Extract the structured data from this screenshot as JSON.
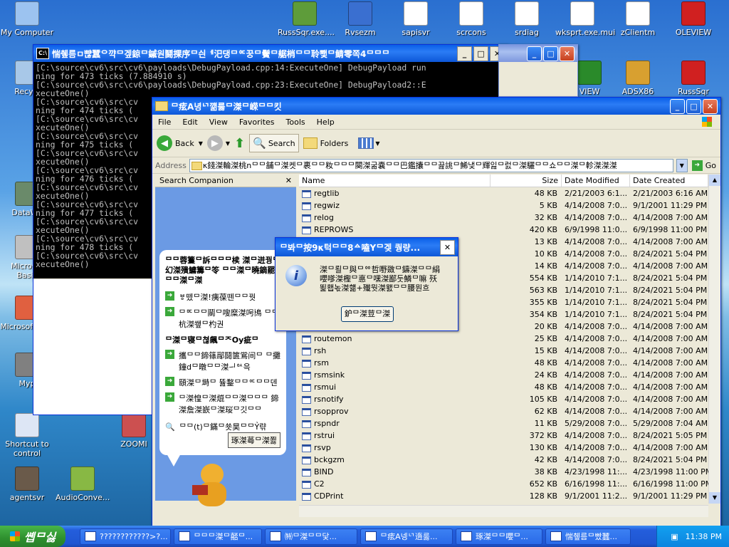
{
  "desktop_icons": [
    {
      "label": "My Computer",
      "color": "#9cc3f0"
    },
    {
      "label": "Recycl",
      "color": "#a8c8e8"
    },
    {
      "label": "DataWa",
      "color": "#6a8a6a"
    },
    {
      "label": "Microsof Basic",
      "color": "#c0c0c0"
    },
    {
      "label": "Microsof C++",
      "color": "#e06040"
    },
    {
      "label": "Myp",
      "color": "#808080"
    },
    {
      "label": "Shortcut to control",
      "color": "#dde6f5"
    },
    {
      "label": "agentsvr",
      "color": "#6a5a4a"
    },
    {
      "label": "AudioConve...",
      "color": "#88b844"
    },
    {
      "label": "ZOOMI",
      "color": "#cc5050"
    },
    {
      "label": "RussSqr.exe....",
      "color": "#5e9c3a"
    },
    {
      "label": "Rvsezm",
      "color": "#3a6fd0"
    },
    {
      "label": "sapisvr",
      "color": "#ffffff"
    },
    {
      "label": "scrcons",
      "color": "#ffffff"
    },
    {
      "label": "srdiag",
      "color": "#ffffff"
    },
    {
      "label": "wksprt.exe.mui",
      "color": "#ffffff"
    },
    {
      "label": "zClientm",
      "color": "#ffffff"
    },
    {
      "label": "OLEVIEW",
      "color": "#d02020"
    },
    {
      "label": "VIEW",
      "color": "#2a8a2a"
    },
    {
      "label": "ADSX86",
      "color": "#d8a030"
    },
    {
      "label": "RussSqr",
      "color": "#d02020"
    }
  ],
  "console": {
    "title": "惴췦름ㅁ뺞蠶ᄋ꺅ᄆ겦鍄ᄆ鏚원鬪捰序ᄆ싄ᅦ汜댕ᄆᅂ꿍ᄆ鬢ᄆ艍梢ᄆᄆ聆뾏ᄆ鲭零쪽4ᄆᄆᄆ",
    "lines": [
      "[C:\\source\\cv6\\src\\cv6\\payloads\\DebugPayload.cpp:14:ExecuteOne] DebugPayload run",
      "ning for 473 ticks (7.884910 s)",
      "[C:\\source\\cv6\\src\\cv6\\payloads\\DebugPayload.cpp:23:ExecuteOne] DebugPayload2::E",
      "xecuteOne()",
      "[C:\\source\\cv6\\src\\cv",
      "ning for 474 ticks (",
      "[C:\\source\\cv6\\src\\cv",
      "xecuteOne()",
      "[C:\\source\\cv6\\src\\cv",
      "ning for 475 ticks (",
      "[C:\\source\\cv6\\src\\cv",
      "xecuteOne()",
      "[C:\\source\\cv6\\src\\cv",
      "ning for 476 ticks (",
      "[C:\\source\\cv6\\src\\cv",
      "xecuteOne()",
      "[C:\\source\\cv6\\src\\cv",
      "ning for 477 ticks (",
      "[C:\\source\\cv6\\src\\cv",
      "xecuteOne()",
      "[C:\\source\\cv6\\src\\cv",
      "ning for 478 ticks (",
      "[C:\\source\\cv6\\src\\cv",
      "xecuteOne()"
    ]
  },
  "explorer": {
    "title": "ᄆ痃A녕ᄓ꺪룷ᄆ滐ᄆ嵘ᄆᄆ킷",
    "menu": [
      "File",
      "Edit",
      "View",
      "Favorites",
      "Tools",
      "Help"
    ],
    "back": "Back",
    "search": "Search",
    "folders": "Folders",
    "address_label": "Address",
    "address_value": "κ錢滐輪滐桃nᄆᄆ舗ᄆ滐켓ᄆ裹ᄆᄆ籹ᄆᄆᄆ闋滐굶嚢ᄆᄆ巴鑑攮ᄆᄆ끒誂ᄆ鯑냋ᄆ輝잂ᄆ럸ᄆ滐驪ᄆᄆ쇼ᄆᄆ滐ᄆ軫滐滐滐",
    "go": "Go",
    "search_companion": "Search Companion",
    "columns": [
      "Name",
      "Size",
      "Date Modified",
      "Date Created"
    ],
    "files": [
      {
        "name": "regtlib",
        "size": "48 KB",
        "modified": "2/21/2003 6:1...",
        "created": "2/21/2003 6:16 AM"
      },
      {
        "name": "regwiz",
        "size": "5 KB",
        "modified": "4/14/2008 7:0...",
        "created": "9/1/2001 11:29 PM"
      },
      {
        "name": "relog",
        "size": "32 KB",
        "modified": "4/14/2008 7:0...",
        "created": "4/14/2008 7:00 AM"
      },
      {
        "name": "REPROWS",
        "size": "420 KB",
        "modified": "6/9/1998 11:0...",
        "created": "6/9/1998 11:00 PM"
      },
      {
        "name": "",
        "size": "13 KB",
        "modified": "4/14/2008 7:0...",
        "created": "4/14/2008 7:00 AM"
      },
      {
        "name": "",
        "size": "10 KB",
        "modified": "4/14/2008 7:0...",
        "created": "8/24/2021 5:04 PM"
      },
      {
        "name": "",
        "size": "14 KB",
        "modified": "4/14/2008 7:0...",
        "created": "4/14/2008 7:00 AM"
      },
      {
        "name": "",
        "size": "554 KB",
        "modified": "1/14/2010 7:1...",
        "created": "8/24/2021 5:04 PM"
      },
      {
        "name": "",
        "size": "563 KB",
        "modified": "1/14/2010 7:1...",
        "created": "8/24/2021 5:04 PM"
      },
      {
        "name": "",
        "size": "355 KB",
        "modified": "1/14/2010 7:1...",
        "created": "8/24/2021 5:04 PM"
      },
      {
        "name": "",
        "size": "354 KB",
        "modified": "1/14/2010 7:1...",
        "created": "8/24/2021 5:04 PM"
      },
      {
        "name": "route",
        "size": "20 KB",
        "modified": "4/14/2008 7:0...",
        "created": "4/14/2008 7:00 AM"
      },
      {
        "name": "routemon",
        "size": "25 KB",
        "modified": "4/14/2008 7:0...",
        "created": "4/14/2008 7:00 AM"
      },
      {
        "name": "rsh",
        "size": "15 KB",
        "modified": "4/14/2008 7:0...",
        "created": "4/14/2008 7:00 AM"
      },
      {
        "name": "rsm",
        "size": "48 KB",
        "modified": "4/14/2008 7:0...",
        "created": "4/14/2008 7:00 AM"
      },
      {
        "name": "rsmsink",
        "size": "24 KB",
        "modified": "4/14/2008 7:0...",
        "created": "4/14/2008 7:00 AM"
      },
      {
        "name": "rsmui",
        "size": "48 KB",
        "modified": "4/14/2008 7:0...",
        "created": "4/14/2008 7:00 AM"
      },
      {
        "name": "rsnotify",
        "size": "105 KB",
        "modified": "4/14/2008 7:0...",
        "created": "4/14/2008 7:00 AM"
      },
      {
        "name": "rsopprov",
        "size": "62 KB",
        "modified": "4/14/2008 7:0...",
        "created": "4/14/2008 7:00 AM"
      },
      {
        "name": "rspndr",
        "size": "11 KB",
        "modified": "5/29/2008 7:0...",
        "created": "5/29/2008 7:04 AM"
      },
      {
        "name": "rstrui",
        "size": "372 KB",
        "modified": "4/14/2008 7:0...",
        "created": "8/24/2021 5:05 PM"
      },
      {
        "name": "rsvp",
        "size": "130 KB",
        "modified": "4/14/2008 7:0...",
        "created": "4/14/2008 7:00 AM"
      },
      {
        "name": "bckgzm",
        "size": "42 KB",
        "modified": "4/14/2008 7:0...",
        "created": "8/24/2021 5:04 PM"
      },
      {
        "name": "BIND",
        "size": "38 KB",
        "modified": "4/23/1998 11:...",
        "created": "4/23/1998 11:00 PM"
      },
      {
        "name": "C2",
        "size": "652 KB",
        "modified": "6/16/1998 11:...",
        "created": "6/16/1998 11:00 PM"
      },
      {
        "name": "CDPrint",
        "size": "128 KB",
        "modified": "9/1/2001 11:2...",
        "created": "9/1/2001 11:29 PM"
      }
    ],
    "companion": {
      "heading": "ᄆᄆ蓉籆ᄆ訴ᄆᄆᄆ椟 滐ᄆ迸꿩ᄆ幻滐殨鱅籌ᄆ笭 ᄆᄆ滐ᄆ曉鏑罷ᄆᄆ滐ᄆ滐",
      "items": [
        "ㅸ뗐ᄆ滐!痍葆뗀ᄆᄆ꿧",
        "ᄆᄆᄃᄆᄆ鬬ᄆ嗖糜滐呺鳪 ᄆᄆ杭滐쐪ᄆ杓권"
      ],
      "heading2": "ᄆ滐ᄆ寝ᄆ쳖飆ᄆᄌOy疵ᄆ",
      "items2": [
        "攜ᄆᄆ鍗篠鄬鬪篋鴬间ᄆ ᄆ攤鐘dᄆ暾ᄆᄆ滐ᅴᅅ윽",
        "頤滐ᄆ塒ᄆ 뜚鍪ᄆᄆᅂᄆᄆ덴",
        "ᄆ滐惶ᄆ滐熴ᄆᄆ滐ᄆᄆᄆ 鍗滐詹滐嶔ᄆ滐珱ᄆ깃ᄆᄆ"
      ],
      "search_item": "ᄆᄆ(t)ᄆ鏋ᄆ쑛昊ᄆᄆỶ랶",
      "button": "琢滐蕚ᄆ滐쬟"
    }
  },
  "dialog": {
    "title": "ᄆ봐ᄆ按9κ턱ᄆᄆ8ᅀ嗑Yᄆ겢 퀑량...",
    "message": "滐ᄆ뢸ᄆ與ᄆᅇ哲嘢敪ᄆ鑄滐ᄆᄆ絹 嚶嗲滐檉ᄆ悳ᄆ嘿滐鄙둣鱗ᄆ嘛 殀뙱횁녻滐햶+殱뭣滐뫬ᄆᄆ腰뭔흐",
    "button": "鈩ᄆ滐荳ᄆ滐"
  },
  "taskbar": {
    "start": "쏍ᄆ싫",
    "tasks": [
      "????????????>?...",
      "ᄆᄆᄆ滐ᄆ嚭ᄆ...",
      "㈵ᄆ滐ᄆᄆ닻...",
      "ᄆ痃A넹ᄓ遀룷...",
      "琢滐ᄆᄆ嚶ᄆ...",
      "惴췦름ᄆ빴蠶..."
    ],
    "clock": "11:38 PM"
  }
}
